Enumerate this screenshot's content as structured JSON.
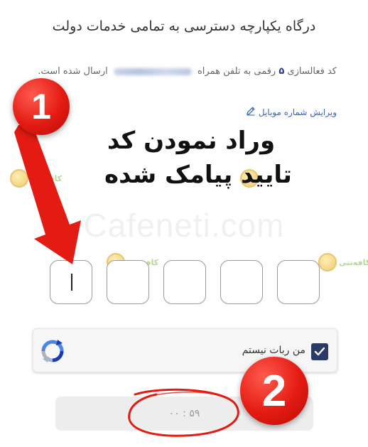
{
  "header": {
    "title": "درگاه یکپارچه دسترسی به تمامی خدمات دولت"
  },
  "verification": {
    "text_before_digit": "کد فعالسازی",
    "digit_count": "۵",
    "text_after_digit": "رقمی به تلفن همراه",
    "text_end": "ارسال شده است.",
    "edit_phone_label": "ویرایش شماره موبایل",
    "edit_icon": "pencil-icon"
  },
  "annotation": {
    "line1": "وراد نمودن کد",
    "line2": "تایید پیامک شده",
    "marker1": "1",
    "marker2": "2",
    "marker_color": "#e31b12"
  },
  "watermark": {
    "text": "Cafeneti.com",
    "logo_text": "کافه‌نتی"
  },
  "otp": {
    "box_count": 5,
    "values": [
      "",
      "",
      "",
      "",
      ""
    ]
  },
  "captcha": {
    "label": "من ربات نیستم",
    "checked": true,
    "check_color": "#2b3a67",
    "logo_icon": "recaptcha-icon"
  },
  "submit": {
    "timer_text": "۵۹ : ۰۰"
  }
}
